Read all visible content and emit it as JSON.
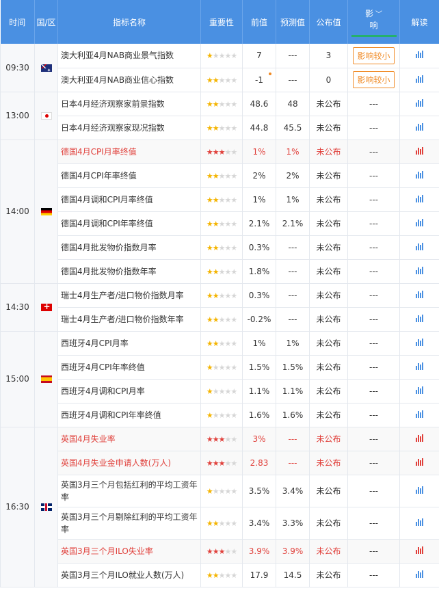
{
  "header": {
    "time": "时间",
    "region": "国/区",
    "name": "指标名称",
    "importance": "重要性",
    "previous": "前值",
    "forecast": "预测值",
    "actual": "公布值",
    "effect_line1": "影",
    "effect_line2": "响",
    "interpret": "解读"
  },
  "colors": {
    "header_bg": "#4a90e2",
    "highlight_text": "#e0403b",
    "star": "#f4b400",
    "effect_border": "#f08a24"
  },
  "groups": [
    {
      "time": "09:30",
      "flag": "au-flag-icon",
      "rows": [
        {
          "name": "澳大利亚4月NAB商业景气指数",
          "stars": 1,
          "prev": "7",
          "fc": "---",
          "act": "3",
          "eff": "影响较小",
          "eff_box": true,
          "hl": false
        },
        {
          "name": "澳大利亚4月NAB商业信心指数",
          "stars": 2,
          "prev": "-1",
          "fc": "---",
          "act": "0",
          "eff": "影响较小",
          "eff_box": true,
          "hl": false,
          "dot": true
        }
      ]
    },
    {
      "time": "13:00",
      "flag": "jp-flag-icon",
      "rows": [
        {
          "name": "日本4月经济观察家前景指数",
          "stars": 2,
          "prev": "48.6",
          "fc": "48",
          "act": "未公布",
          "eff": "---",
          "hl": false
        },
        {
          "name": "日本4月经济观察家现况指数",
          "stars": 2,
          "prev": "44.8",
          "fc": "45.5",
          "act": "未公布",
          "eff": "---",
          "hl": false
        }
      ]
    },
    {
      "time": "14:00",
      "flag": "de-flag-icon",
      "rows": [
        {
          "name": "德国4月CPI月率终值",
          "stars": 3,
          "prev": "1%",
          "fc": "1%",
          "act": "未公布",
          "eff": "---",
          "hl": true
        },
        {
          "name": "德国4月CPI年率终值",
          "stars": 2,
          "prev": "2%",
          "fc": "2%",
          "act": "未公布",
          "eff": "---",
          "hl": false
        },
        {
          "name": "德国4月调和CPI月率终值",
          "stars": 2,
          "prev": "1%",
          "fc": "1%",
          "act": "未公布",
          "eff": "---",
          "hl": false
        },
        {
          "name": "德国4月调和CPI年率终值",
          "stars": 2,
          "prev": "2.1%",
          "fc": "2.1%",
          "act": "未公布",
          "eff": "---",
          "hl": false
        },
        {
          "name": "德国4月批发物价指数月率",
          "stars": 2,
          "prev": "0.3%",
          "fc": "---",
          "act": "未公布",
          "eff": "---",
          "hl": false
        },
        {
          "name": "德国4月批发物价指数年率",
          "stars": 2,
          "prev": "1.8%",
          "fc": "---",
          "act": "未公布",
          "eff": "---",
          "hl": false
        }
      ]
    },
    {
      "time": "14:30",
      "flag": "ch-flag-icon",
      "rows": [
        {
          "name": "瑞士4月生产者/进口物价指数月率",
          "stars": 2,
          "prev": "0.3%",
          "fc": "---",
          "act": "未公布",
          "eff": "---",
          "hl": false
        },
        {
          "name": "瑞士4月生产者/进口物价指数年率",
          "stars": 2,
          "prev": "-0.2%",
          "fc": "---",
          "act": "未公布",
          "eff": "---",
          "hl": false
        }
      ]
    },
    {
      "time": "15:00",
      "flag": "es-flag-icon",
      "rows": [
        {
          "name": "西班牙4月CPI月率",
          "stars": 2,
          "prev": "1%",
          "fc": "1%",
          "act": "未公布",
          "eff": "---",
          "hl": false
        },
        {
          "name": "西班牙4月CPI年率终值",
          "stars": 1,
          "prev": "1.5%",
          "fc": "1.5%",
          "act": "未公布",
          "eff": "---",
          "hl": false
        },
        {
          "name": "西班牙4月调和CPI月率",
          "stars": 1,
          "prev": "1.1%",
          "fc": "1.1%",
          "act": "未公布",
          "eff": "---",
          "hl": false
        },
        {
          "name": "西班牙4月调和CPI年率终值",
          "stars": 1,
          "prev": "1.6%",
          "fc": "1.6%",
          "act": "未公布",
          "eff": "---",
          "hl": false
        }
      ]
    },
    {
      "time": "16:30",
      "flag": "gb-flag-icon",
      "rows": [
        {
          "name": "英国4月失业率",
          "stars": 3,
          "prev": "3%",
          "fc": "---",
          "act": "未公布",
          "eff": "---",
          "hl": true
        },
        {
          "name": "英国4月失业金申请人数(万人)",
          "stars": 3,
          "prev": "2.83",
          "fc": "---",
          "act": "未公布",
          "eff": "---",
          "hl": true
        },
        {
          "name": "英国3月三个月包括红利的平均工资年率",
          "stars": 1,
          "prev": "3.5%",
          "fc": "3.4%",
          "act": "未公布",
          "eff": "---",
          "hl": false,
          "tall": true
        },
        {
          "name": "英国3月三个月剔除红利的平均工资年率",
          "stars": 2,
          "prev": "3.4%",
          "fc": "3.3%",
          "act": "未公布",
          "eff": "---",
          "hl": false,
          "tall": true
        },
        {
          "name": "英国3月三个月ILO失业率",
          "stars": 3,
          "prev": "3.9%",
          "fc": "3.9%",
          "act": "未公布",
          "eff": "---",
          "hl": true
        },
        {
          "name": "英国3月三个月ILO就业人数(万人)",
          "stars": 2,
          "prev": "17.9",
          "fc": "14.5",
          "act": "未公布",
          "eff": "---",
          "hl": false
        }
      ]
    }
  ]
}
